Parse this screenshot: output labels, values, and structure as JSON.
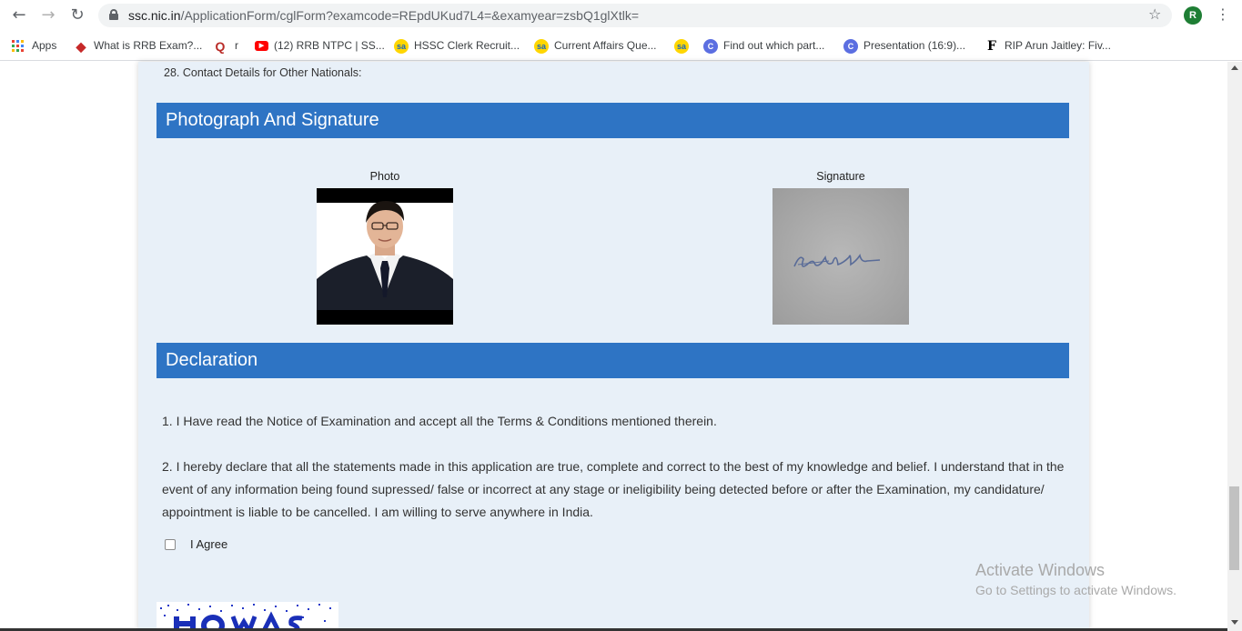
{
  "browser": {
    "url_host": "ssc.nic.in",
    "url_path": "/ApplicationForm/cglForm?examcode=REpdUKud7L4=&examyear=zsbQ1glXtlk=",
    "avatar_letter": "R"
  },
  "bookmarks": [
    {
      "label": "Apps",
      "icon": "apps-grid-icon"
    },
    {
      "label": "What is RRB Exam?...",
      "icon": "diamond-bookmark-icon"
    },
    {
      "label": "r",
      "icon": "quora-q-icon"
    },
    {
      "label": "(12) RRB NTPC | SS...",
      "icon": "youtube-icon"
    },
    {
      "label": "HSSC Clerk Recruit...",
      "icon": "sa-icon"
    },
    {
      "label": "Current Affairs Que...",
      "icon": "sa-icon"
    },
    {
      "label": "",
      "icon": "sa-icon"
    },
    {
      "label": "Find out which part...",
      "icon": "c-circle-icon"
    },
    {
      "label": "Presentation (16:9)...",
      "icon": "c-circle-icon"
    },
    {
      "label": "RIP Arun Jaitley: Fiv...",
      "icon": "f-letter-icon"
    }
  ],
  "form": {
    "contact_other_nationals": "28. Contact Details for Other Nationals:",
    "photo_section_title": "Photograph And Signature",
    "photo_caption": "Photo",
    "signature_caption": "Signature",
    "declaration_title": "Declaration",
    "declaration_1": "1. I Have read the Notice of Examination and accept all the Terms & Conditions mentioned therein.",
    "declaration_2": "2. I hereby declare that all the statements made in this application are true, complete and correct to the best of my knowledge and belief. I understand that in the event of any information being found supressed/ false or incorrect at any stage or ineligibility being detected before or after the Examination, my candidature/ appointment is liable to be cancelled. I am willing to serve anywhere in India.",
    "agree_label": "I Agree",
    "agree_checked": false
  },
  "watermark": {
    "line1": "Activate Windows",
    "line2": "Go to Settings to activate Windows."
  },
  "colors": {
    "section_header": "#2e74c4",
    "panel_bg": "#e8f0f8"
  }
}
